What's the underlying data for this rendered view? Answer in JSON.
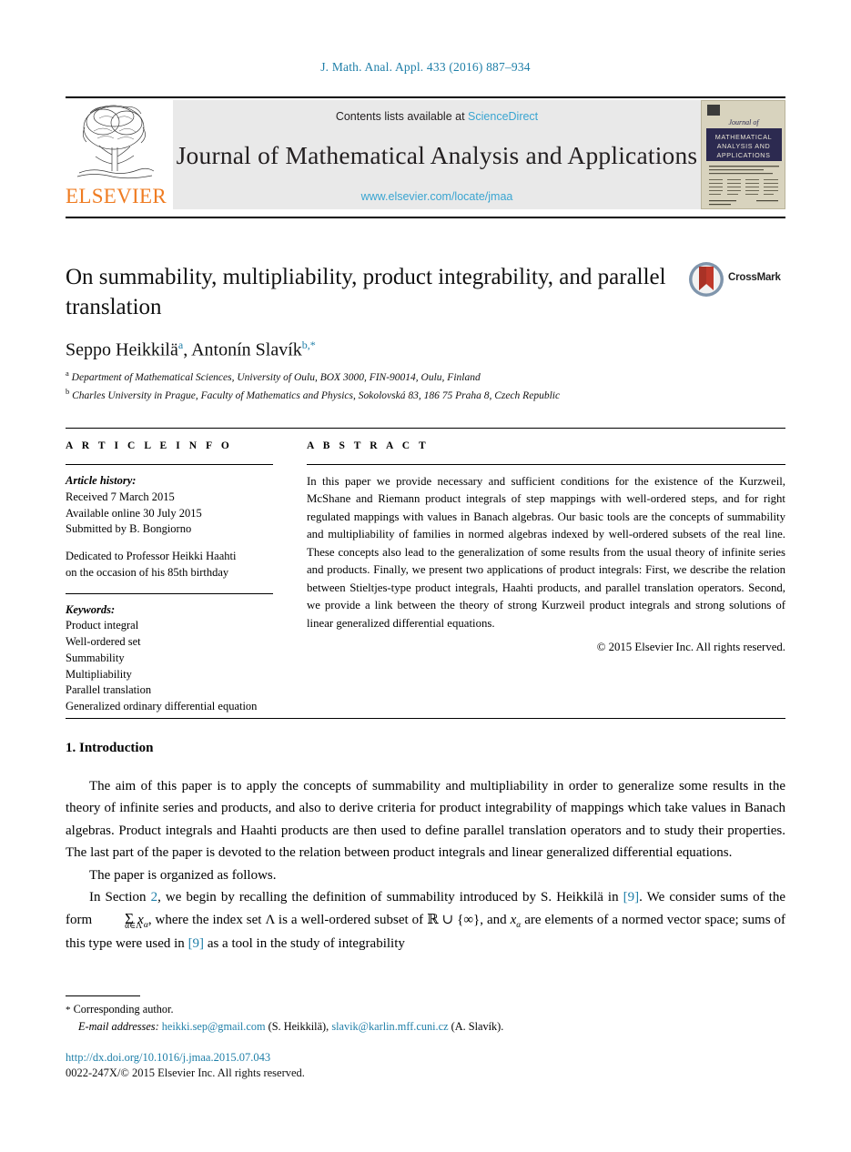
{
  "running_head": "J. Math. Anal. Appl. 433 (2016) 887–934",
  "header": {
    "publisher": "ELSEVIER",
    "contents_prefix": "Contents lists available at",
    "sciencedirect": "ScienceDirect",
    "journal_name": "Journal of Mathematical Analysis and Applications",
    "journal_url": "www.elsevier.com/locate/jmaa",
    "cover_title_lines": [
      "Journal of",
      "MATHEMATICAL",
      "ANALYSIS AND",
      "APPLICATIONS"
    ],
    "crossmark_label": "CrossMark"
  },
  "article": {
    "title": "On summability, multipliability, product integrability, and parallel translation",
    "authors_html": "Seppo Heikkilä<sup>a</sup>, Antonín Slavík<sup>b,*</sup>",
    "affiliations": [
      {
        "marker": "a",
        "text": "Department of Mathematical Sciences, University of Oulu, BOX 3000, FIN-90014, Oulu, Finland"
      },
      {
        "marker": "b",
        "text": "Charles University in Prague, Faculty of Mathematics and Physics, Sokolovská 83, 186 75 Praha 8, Czech Republic"
      }
    ]
  },
  "info": {
    "kicker": "A R T I C L E   I N F O",
    "history_heading": "Article history:",
    "history": [
      "Received 7 March 2015",
      "Available online 30 July 2015",
      "Submitted by B. Bongiorno"
    ],
    "dedication": [
      "Dedicated to Professor Heikki Haahti",
      "on the occasion of his 85th birthday"
    ],
    "keywords_heading": "Keywords:",
    "keywords": [
      "Product integral",
      "Well-ordered set",
      "Summability",
      "Multipliability",
      "Parallel translation",
      "Generalized ordinary differential equation"
    ]
  },
  "abstract": {
    "kicker": "A B S T R A C T",
    "text": "In this paper we provide necessary and sufficient conditions for the existence of the Kurzweil, McShane and Riemann product integrals of step mappings with well-ordered steps, and for right regulated mappings with values in Banach algebras. Our basic tools are the concepts of summability and multipliability of families in normed algebras indexed by well-ordered subsets of the real line. These concepts also lead to the generalization of some results from the usual theory of infinite series and products. Finally, we present two applications of product integrals: First, we describe the relation between Stieltjes-type product integrals, Haahti products, and parallel translation operators. Second, we provide a link between the theory of strong Kurzweil product integrals and strong solutions of linear generalized differential equations.",
    "copyright": "© 2015 Elsevier Inc. All rights reserved."
  },
  "body": {
    "section_heading": "1. Introduction",
    "para1": "The aim of this paper is to apply the concepts of summability and multipliability in order to generalize some results in the theory of infinite series and products, and also to derive criteria for product integrability of mappings which take values in Banach algebras. Product integrals and Haahti products are then used to define parallel translation operators and to study their properties. The last part of the paper is devoted to the relation between product integrals and linear generalized differential equations.",
    "para2": "The paper is organized as follows.",
    "para3_a": "In Section",
    "para3_ref_section": "2",
    "para3_b": ", we begin by recalling the definition of summability introduced by S. Heikkilä in",
    "para3_ref_9a": "[9]",
    "para3_c": ". We consider sums of the form",
    "sum_symbol": "Σ",
    "sum_limit": "α∈Λ",
    "sum_term": "x",
    "sum_term_sub": "α",
    "para3_d": ", where the index set Λ is a well-ordered subset of ℝ ∪ {∞}, and",
    "para3_e": "are elements of a normed vector space; sums of this type were used in",
    "para3_ref_9b": "[9]",
    "para3_f": "as a tool in the study of integrability"
  },
  "footer": {
    "corresponding_marker": "*",
    "corresponding_text": "Corresponding author.",
    "email_label": "E-mail addresses:",
    "email1": "heikki.sep@gmail.com",
    "email1_owner": "(S. Heikkilä),",
    "email2": "slavik@karlin.mff.cuni.cz",
    "email2_owner": "(A. Slavík).",
    "doi": "http://dx.doi.org/10.1016/j.jmaa.2015.07.043",
    "issn_line": "0022-247X/© 2015 Elsevier Inc. All rights reserved."
  },
  "colors": {
    "link": "#1f7fa8",
    "header_link": "#3aa5d1",
    "elsevier_orange": "#ef7c22",
    "cover_bg": "#d8d3be",
    "cover_band": "#2c2a50"
  }
}
